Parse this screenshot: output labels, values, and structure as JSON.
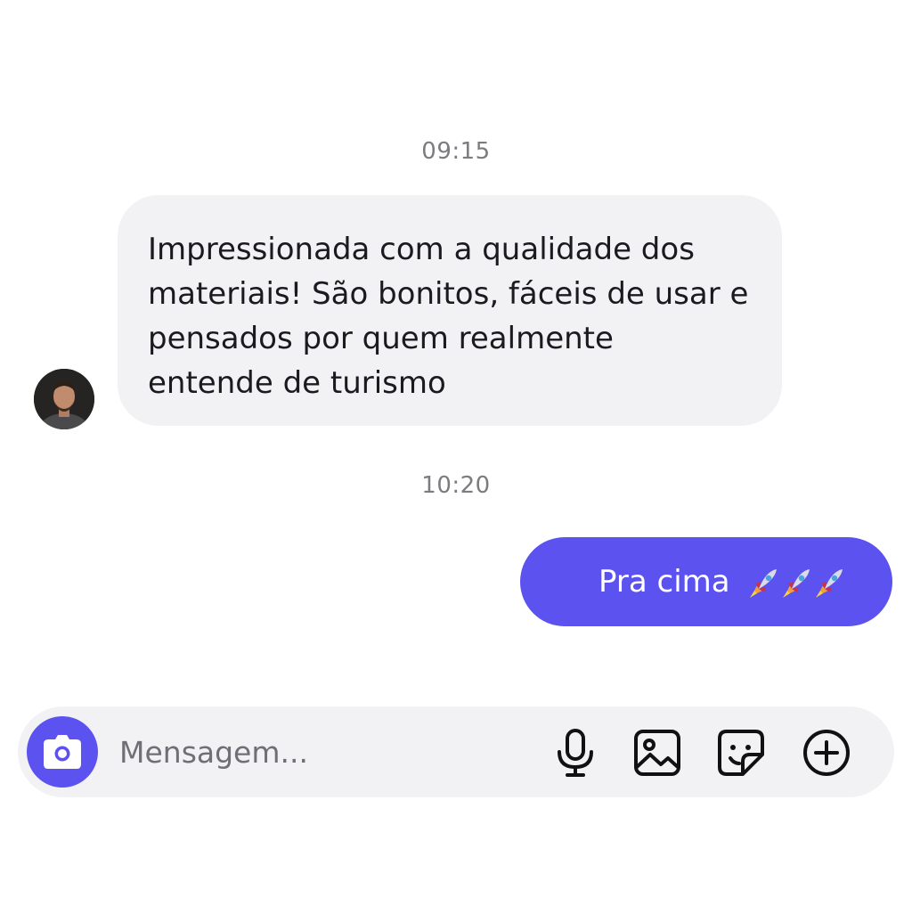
{
  "conversation": {
    "messages": [
      {
        "time": "09:15",
        "sender": "other",
        "lines": [
          "Impressionada com a qualidade dos",
          "materiais! São bonitos, fáceis de usar e",
          "pensados por quem realmente",
          "entende de turismo"
        ]
      },
      {
        "time": "10:20",
        "sender": "self",
        "text": "Pra cima",
        "emoji": "rocket-emoji x3"
      }
    ]
  },
  "composer": {
    "placeholder": "Mensagem...",
    "icons": [
      "camera-icon",
      "microphone-icon",
      "image-icon",
      "sticker-icon",
      "plus-circle-icon"
    ]
  },
  "colors": {
    "accent": "#5b52f0",
    "incoming_bubble": "#f2f2f4",
    "timestamp": "#7b7b80",
    "background": "#ffffff"
  }
}
